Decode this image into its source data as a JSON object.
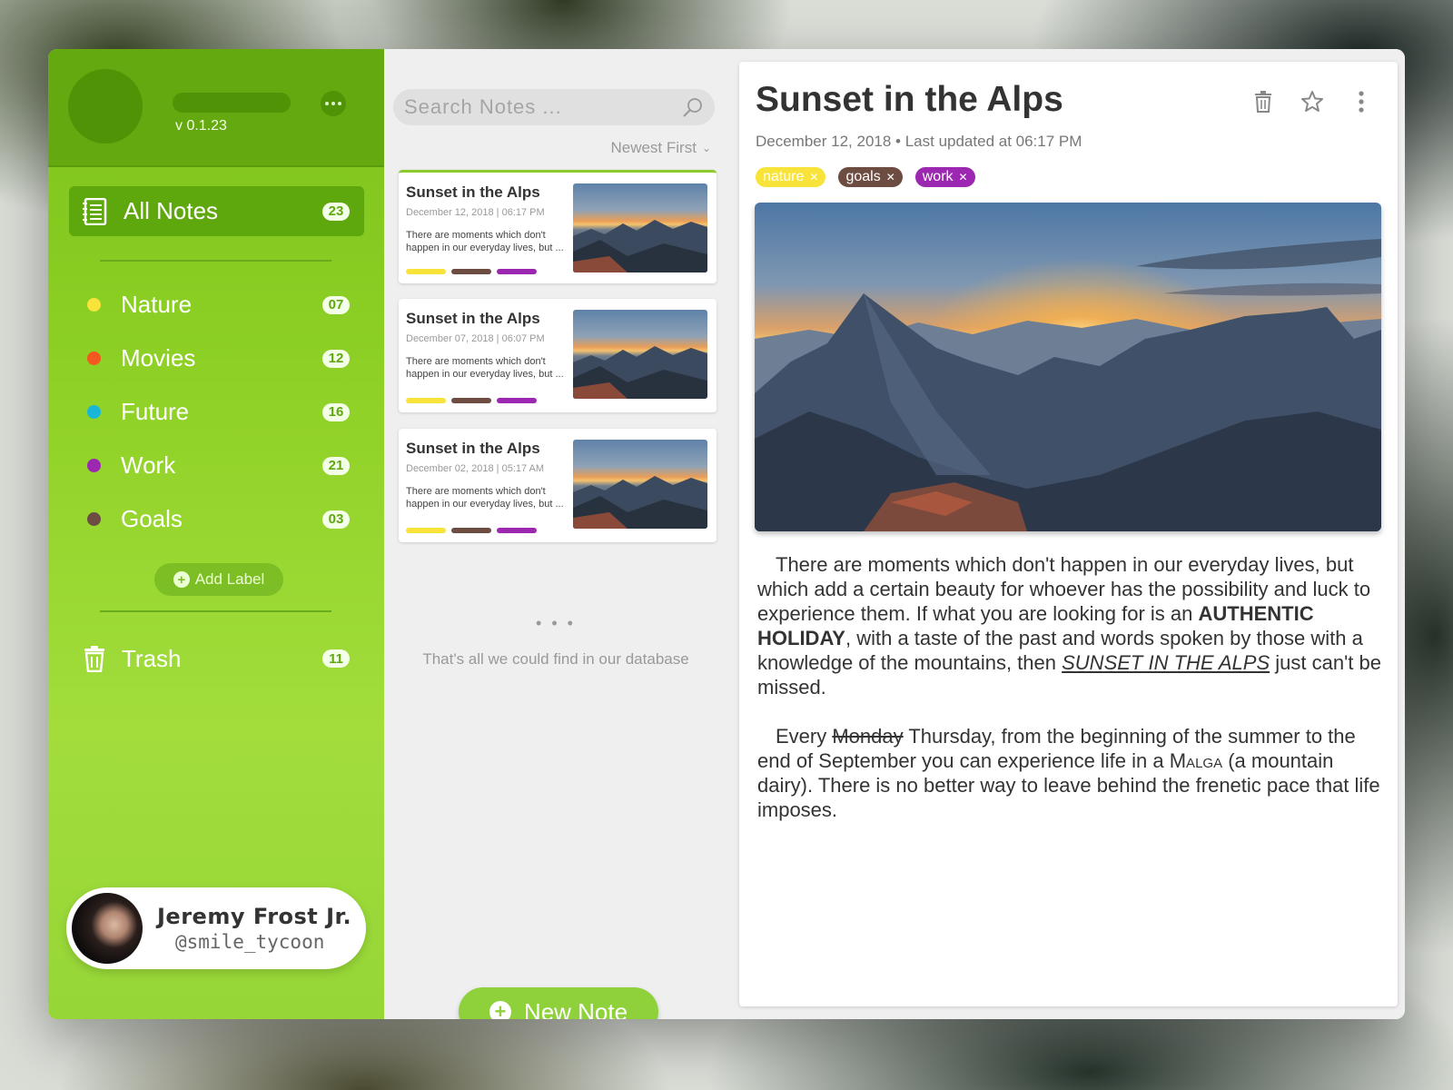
{
  "sidebar": {
    "version": "v 0.1.23",
    "all_notes": {
      "label": "All Notes",
      "count": "23"
    },
    "labels": [
      {
        "label": "Nature",
        "count": "07",
        "color": "#f7e33a"
      },
      {
        "label": "Movies",
        "count": "12",
        "color": "#f2581f"
      },
      {
        "label": "Future",
        "count": "16",
        "color": "#19b6d8"
      },
      {
        "label": "Work",
        "count": "21",
        "color": "#9c27b0"
      },
      {
        "label": "Goals",
        "count": "03",
        "color": "#6d4c41"
      }
    ],
    "add_label": "Add Label",
    "trash": {
      "label": "Trash",
      "count": "11"
    },
    "user": {
      "name": "Jeremy Frost Jr.",
      "handle": "@smile_tycoon"
    }
  },
  "list": {
    "search_placeholder": "Search Notes ...",
    "sort": "Newest First",
    "notes": [
      {
        "title": "Sunset in the Alps",
        "date": "December 12, 2018  |  06:17 PM",
        "excerpt": "There are moments which don't happen in our everyday lives, but ..."
      },
      {
        "title": "Sunset in the Alps",
        "date": "December 07, 2018  |  06:07 PM",
        "excerpt": "There are moments which don't happen in our everyday lives, but ..."
      },
      {
        "title": "Sunset in the Alps",
        "date": "December 02, 2018  |  05:17 AM",
        "excerpt": "There are moments which don't happen in our everyday lives, but ..."
      }
    ],
    "more": "• • •",
    "end_text": "That's all we could find in our database",
    "new_note": "New Note",
    "label_colors": [
      "#f7e33a",
      "#6d4c41",
      "#9c27b0"
    ]
  },
  "detail": {
    "title": "Sunset in the Alps",
    "meta": "December 12, 2018 • Last updated at 06:17 PM",
    "tags": [
      {
        "label": "nature",
        "bg": "#f7e33a",
        "fg": "#ffffff"
      },
      {
        "label": "goals",
        "bg": "#6d4c41",
        "fg": "#ffffff"
      },
      {
        "label": "work",
        "bg": "#9c27b0",
        "fg": "#ffffff"
      }
    ],
    "para1": {
      "a": "There are moments which don't happen in our everyday lives, but which add a certain beauty for whoever has the possibility and luck to experience them. If what you are looking for is an ",
      "b": "AUTHENTIC HOLIDAY",
      "c": ", with a taste of the past and words spoken by those with a knowledge of the mountains, then ",
      "d": "SUNSET IN THE ALPS",
      "e": " just can't be missed."
    },
    "para2": {
      "a": "Every ",
      "strike": "Monday",
      "b": " Thursday, from the beginning of the summer to the end of  September you can experience life in a ",
      "sc": "Malga",
      "c": " (a mountain dairy). There is no better way to leave behind the frenetic pace that life imposes."
    }
  }
}
